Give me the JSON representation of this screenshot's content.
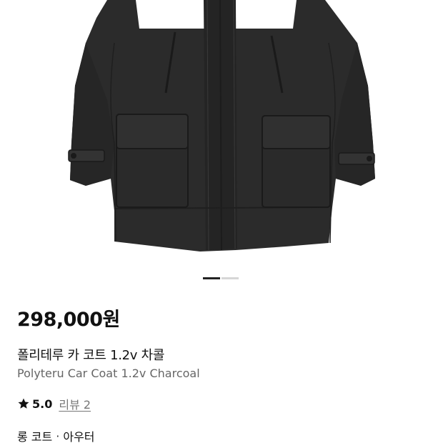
{
  "product": {
    "image_alt": "charcoal field coat",
    "carousel": {
      "total": 2,
      "current": 1
    },
    "price": "298,000원",
    "title_ko": "폴리테루 카 코트 1.2v 차콜",
    "title_en": "Polyteru Car Coat 1.2v Charcoal",
    "rating": {
      "icon": "star-icon",
      "score": "5.0",
      "reviews_label": "리뷰 2"
    },
    "categories": {
      "primary": "롱 코트",
      "separator": "·",
      "secondary": "아우터"
    }
  },
  "colors": {
    "coat": "#2b2b2b",
    "text_primary": "#111111",
    "text_secondary": "#666666",
    "indicator_active": "#222222",
    "indicator_inactive": "#d6d6d6"
  }
}
